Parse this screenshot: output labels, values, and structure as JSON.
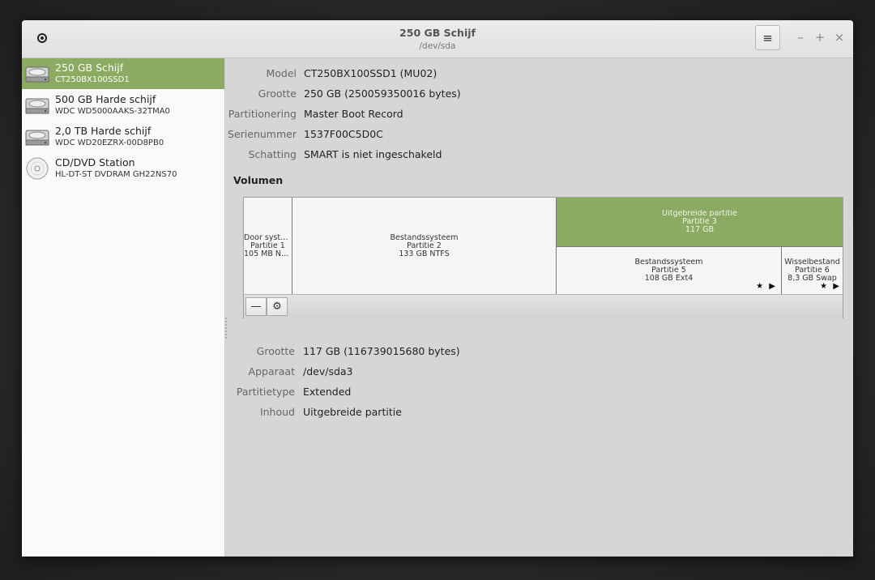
{
  "window": {
    "title": "250 GB Schijf",
    "subtitle": "/dev/sda"
  },
  "icons": {
    "record": "record-icon",
    "menu": "hamburger-menu-icon",
    "minimize": "minimize-icon",
    "maximize": "maximize-icon",
    "close": "close-icon",
    "disk": "hard-disk-icon",
    "optical": "optical-disc-icon",
    "remove": "minus-icon",
    "settings": "gears-icon",
    "star": "star-icon",
    "play": "play-icon"
  },
  "glyphs": {
    "menu": "≡",
    "minimize": "–",
    "maximize": "+",
    "close": "×",
    "remove": "—",
    "settings": "⚙",
    "marks": "★ ▶"
  },
  "sidebar": {
    "items": [
      {
        "name": "250 GB Schijf",
        "model": "CT250BX100SSD1",
        "selected": true
      },
      {
        "name": "500 GB Harde schijf",
        "model": "WDC WD5000AAKS-32TMA0",
        "selected": false
      },
      {
        "name": "2,0 TB Harde schijf",
        "model": "WDC WD20EZRX-00D8PB0",
        "selected": false
      },
      {
        "name": "CD/DVD Station",
        "model": "HL-DT-ST DVDRAM GH22NS70",
        "selected": false
      }
    ]
  },
  "disk_info": [
    {
      "label": "Model",
      "value": "CT250BX100SSD1 (MU02)"
    },
    {
      "label": "Grootte",
      "value": "250 GB (250059350016 bytes)"
    },
    {
      "label": "Partitionering",
      "value": "Master Boot Record"
    },
    {
      "label": "Serienummer",
      "value": "1537F00C5D0C"
    },
    {
      "label": "Schatting",
      "value": "SMART is niet ingeschakeld"
    }
  ],
  "volumes": {
    "heading": "Volumen",
    "partitions": [
      {
        "l1": "Door syste…",
        "l2": "Partitie 1",
        "l3": "105 MB NT…"
      },
      {
        "l1": "Bestandssysteem",
        "l2": "Partitie 2",
        "l3": "133 GB NTFS"
      },
      {
        "l1": "Uitgebreide partitie",
        "l2": "Partitie 3",
        "l3": "117 GB"
      },
      {
        "l1": "Bestandssysteem",
        "l2": "Partitie 5",
        "l3": "108 GB Ext4"
      },
      {
        "l1": "Wisselbestand",
        "l2": "Partitie 6",
        "l3": "8,3 GB Swap"
      }
    ]
  },
  "selected_volume": [
    {
      "label": "Grootte",
      "value": "117 GB (116739015680 bytes)"
    },
    {
      "label": "Apparaat",
      "value": "/dev/sda3"
    },
    {
      "label": "Partitietype",
      "value": "Extended"
    },
    {
      "label": "Inhoud",
      "value": "Uitgebreide partitie"
    }
  ],
  "colors": {
    "accent": "#8aab61"
  }
}
